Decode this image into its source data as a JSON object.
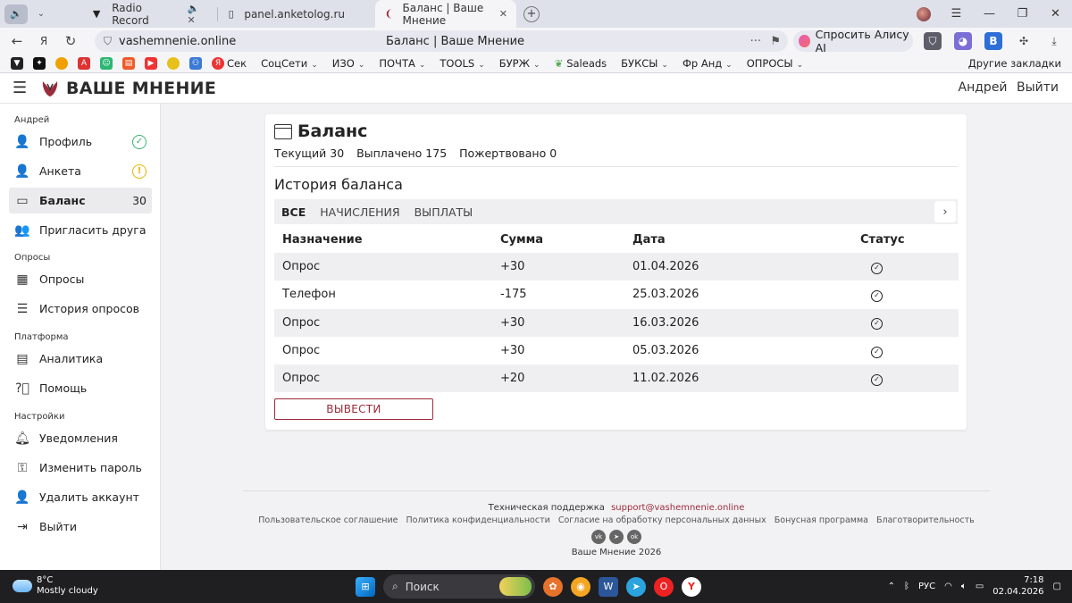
{
  "browser": {
    "tabs": [
      {
        "label": "Radio Record",
        "extra": "🔈 ✕"
      },
      {
        "label": "panel.anketolog.ru",
        "extra": ""
      },
      {
        "label": "Баланс | Ваше Мнение",
        "extra": "✕"
      }
    ],
    "url": "vashemnenie.online",
    "page_title": "Баланс | Ваше Мнение",
    "alice_label": "Спросить Алису AI",
    "bookmarks": [
      {
        "label": "Сек",
        "menu": false
      },
      {
        "label": "СоцСети",
        "menu": true
      },
      {
        "label": "ИЗО",
        "menu": true
      },
      {
        "label": "ПОЧТА",
        "menu": true
      },
      {
        "label": "TOOLS",
        "menu": true
      },
      {
        "label": "БУРЖ",
        "menu": true
      },
      {
        "label": "Saleads",
        "menu": false
      },
      {
        "label": "БУКСЫ",
        "menu": true
      },
      {
        "label": "Фр Анд",
        "menu": true
      },
      {
        "label": "ОПРОСЫ",
        "menu": true
      }
    ],
    "other_bookmarks": "Другие закладки"
  },
  "site": {
    "logo": "ВАШЕ МНЕНИЕ",
    "user_name": "Андрей",
    "logout": "Выйти"
  },
  "sidebar": {
    "sections": [
      {
        "title": "Андрей"
      },
      {
        "title": "Опросы"
      },
      {
        "title": "Платформа"
      },
      {
        "title": "Настройки"
      }
    ],
    "items": [
      {
        "label": "Профиль",
        "icon": "user-icon"
      },
      {
        "label": "Анкета",
        "icon": "user-list-icon"
      },
      {
        "label": "Баланс",
        "icon": "window-icon",
        "badge": "30"
      },
      {
        "label": "Пригласить друга",
        "icon": "users-icon"
      },
      {
        "label": "Опросы",
        "icon": "grid-icon"
      },
      {
        "label": "История опросов",
        "icon": "list-icon"
      },
      {
        "label": "Аналитика",
        "icon": "analytics-icon"
      },
      {
        "label": "Помощь",
        "icon": "help-icon"
      },
      {
        "label": "Уведомления",
        "icon": "bell-icon"
      },
      {
        "label": "Изменить пароль",
        "icon": "key-icon"
      },
      {
        "label": "Удалить аккаунт",
        "icon": "user-remove-icon"
      },
      {
        "label": "Выйти",
        "icon": "logout-icon"
      }
    ]
  },
  "balance": {
    "title": "Баланс",
    "current": "Текущий 30",
    "paid": "Выплачено 175",
    "donated": "Пожертвовано 0",
    "history_title": "История баланса",
    "tabs": [
      "ВСЕ",
      "НАЧИСЛЕНИЯ",
      "ВЫПЛАТЫ"
    ],
    "columns": [
      "Назначение",
      "Сумма",
      "Дата",
      "Статус"
    ],
    "rows": [
      {
        "purpose": "Опрос",
        "amount": "+30",
        "date": "01.04.2026",
        "status": "done"
      },
      {
        "purpose": "Телефон",
        "amount": "-175",
        "date": "25.03.2026",
        "status": "done"
      },
      {
        "purpose": "Опрос",
        "amount": "+30",
        "date": "16.03.2026",
        "status": "done"
      },
      {
        "purpose": "Опрос",
        "amount": "+30",
        "date": "05.03.2026",
        "status": "done"
      },
      {
        "purpose": "Опрос",
        "amount": "+20",
        "date": "11.02.2026",
        "status": "done"
      }
    ],
    "withdraw_label": "ВЫВЕСТИ"
  },
  "footer": {
    "support_label": "Техническая поддержка",
    "support_email": "support@vashemnenie.online",
    "links": [
      "Пользовательское соглашение",
      "Политика конфиденциальности",
      "Согласие на обработку персональных данных",
      "Бонусная программа",
      "Благотворительность"
    ],
    "copyright": "Ваше Мнение 2026"
  },
  "taskbar": {
    "temp": "8°C",
    "weather": "Mostly cloudy",
    "search_placeholder": "Поиск",
    "lang": "РУС",
    "time": "7:18",
    "date": "02.04.2026"
  },
  "colors": {
    "accent": "#9c2b3b",
    "ok": "#3bb273",
    "warn": "#e8b400"
  }
}
